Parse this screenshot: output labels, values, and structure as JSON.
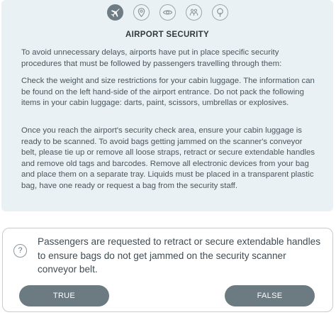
{
  "nav": {
    "icons": [
      {
        "name": "plane-icon",
        "active": true
      },
      {
        "name": "location-pin-icon",
        "active": false
      },
      {
        "name": "eye-icon",
        "active": false
      },
      {
        "name": "people-icon",
        "active": false
      },
      {
        "name": "tree-icon",
        "active": false
      }
    ]
  },
  "passage": {
    "title": "AIRPORT SECURITY",
    "paragraphs": [
      "To avoid unnecessary delays, airports have put in place specific security procedures that must be followed by passengers travelling through them:",
      "Check the weight and size restrictions for your cabin luggage. The information can be found on the left hand-side of the airport entrance. Do not pack the following items in your cabin luggage: darts, paint, scissors, umbrellas or explosives.",
      "Once you reach the airport's security check area, ensure your cabin luggage is ready to be scanned. To avoid bags getting jammed on the scanner's conveyor belt, please tie up or remove all loose straps, retract or secure extendable handles and remove old tags and barcodes. Remove all electronic devices from your bag and place them on a separate tray. Liquids must be placed in a transparent plastic bag, have one ready or request a bag from the security staff."
    ]
  },
  "question": {
    "icon_text": "?",
    "text": "Passengers are requested to retract or secure extendable handles to ensure bags do not get jammed on the security scanner conveyor belt.",
    "true_label": "TRUE",
    "false_label": "FALSE"
  },
  "colors": {
    "panel_bg": "#e9f1f4",
    "button_bg": "#6c7a82",
    "active_icon_bg": "#6f7c84"
  }
}
